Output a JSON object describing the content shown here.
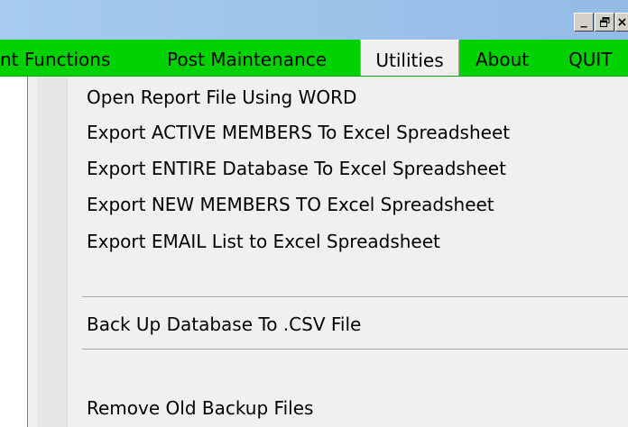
{
  "window": {
    "controls": {
      "minimize": "_",
      "restore": "Θ",
      "close": "×"
    },
    "title_bar_color": "#a6caf0"
  },
  "menu_bar": {
    "background": "#00d200",
    "items": [
      {
        "label": "nt Functions"
      },
      {
        "label": "Post Maintenance"
      },
      {
        "label": "Utilities",
        "active": true
      },
      {
        "label": "About"
      },
      {
        "label": "QUIT"
      }
    ]
  },
  "dropdown": {
    "items": [
      {
        "label": "Open Report File Using WORD"
      },
      {
        "label": "Export ACTIVE MEMBERS To Excel Spreadsheet"
      },
      {
        "label": "Export ENTIRE Database To Excel Spreadsheet"
      },
      {
        "label": "Export NEW MEMBERS TO Excel Spreadsheet"
      },
      {
        "label": "Export EMAIL List to Excel Spreadsheet"
      },
      {
        "label": "Back Up Database To .CSV File"
      },
      {
        "label": "Remove Old Backup Files"
      }
    ]
  }
}
